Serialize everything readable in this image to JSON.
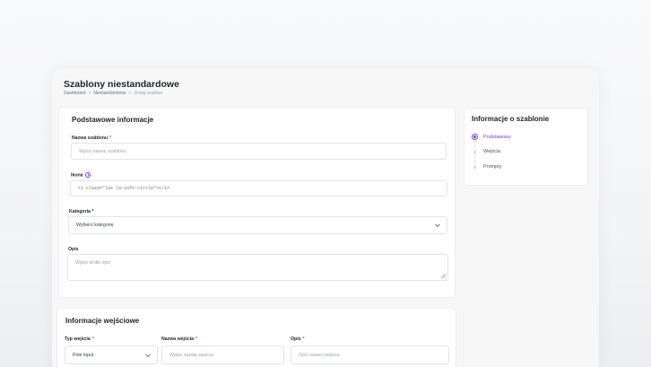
{
  "header": {
    "title": "Szablony niestandardowe",
    "breadcrumb": [
      "Dashboard",
      "Niestandardowe",
      "Dodaj szablon"
    ],
    "separator": ">"
  },
  "basic_info": {
    "title": "Podstawowe informacje",
    "name_label": "Nazwa szablonu",
    "name_placeholder": "Wpisz nazwę szablonu",
    "icon_label": "Ikona",
    "icon_value": "<i class=\"las la-info-circle\"></i>",
    "category_label": "Kategoria *",
    "category_value": "Wybierz kategorię",
    "description_label": "Opis",
    "description_placeholder": "Wpisz krótki opis",
    "required_mark": "*"
  },
  "template_info": {
    "title": "Informacje o szablonie",
    "steps": [
      "Podstawowy",
      "Wejścia",
      "Prompty"
    ],
    "active_step": 0
  },
  "input_info": {
    "title": "Informacje wejściowe",
    "type_label": "Typ wejścia",
    "type_value": "Pole Input",
    "name_label": "Nazwa wejścia",
    "name_placeholder": "Wpisz nazwę wejścia",
    "desc_label": "Opis",
    "desc_placeholder": "Opis nazwy wejścia",
    "required_mark": "*"
  },
  "colors": {
    "accent": "#7c3aed",
    "required": "#ef4444"
  }
}
